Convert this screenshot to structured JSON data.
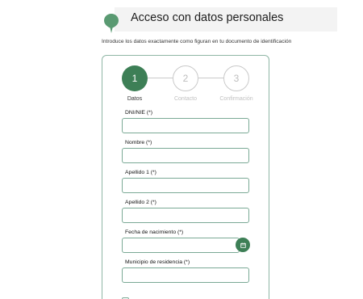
{
  "header": {
    "title": "Acceso con datos personales",
    "icon": "location-pin-icon"
  },
  "subtitle": "Introduce los datos exactamente como figuran en tu documento de identificación",
  "stepper": {
    "steps": [
      {
        "number": "1",
        "label": "Datos",
        "state": "active"
      },
      {
        "number": "2",
        "label": "Contacto",
        "state": "inactive"
      },
      {
        "number": "3",
        "label": "Confirmación",
        "state": "inactive"
      }
    ]
  },
  "form": {
    "fields": [
      {
        "label": "DNI/NIE (*)",
        "value": ""
      },
      {
        "label": "Nombre (*)",
        "value": ""
      },
      {
        "label": "Apellido 1 (*)",
        "value": ""
      },
      {
        "label": "Apellido 2 (*)",
        "value": ""
      },
      {
        "label": "Fecha de nacimiento (*)",
        "value": "",
        "icon": "calendar-icon"
      },
      {
        "label": "Municipio de residencia (*)",
        "value": ""
      }
    ]
  },
  "colors": {
    "accent": "#3d7f56",
    "border": "#7aa995",
    "inactive": "#c9c9c9"
  }
}
